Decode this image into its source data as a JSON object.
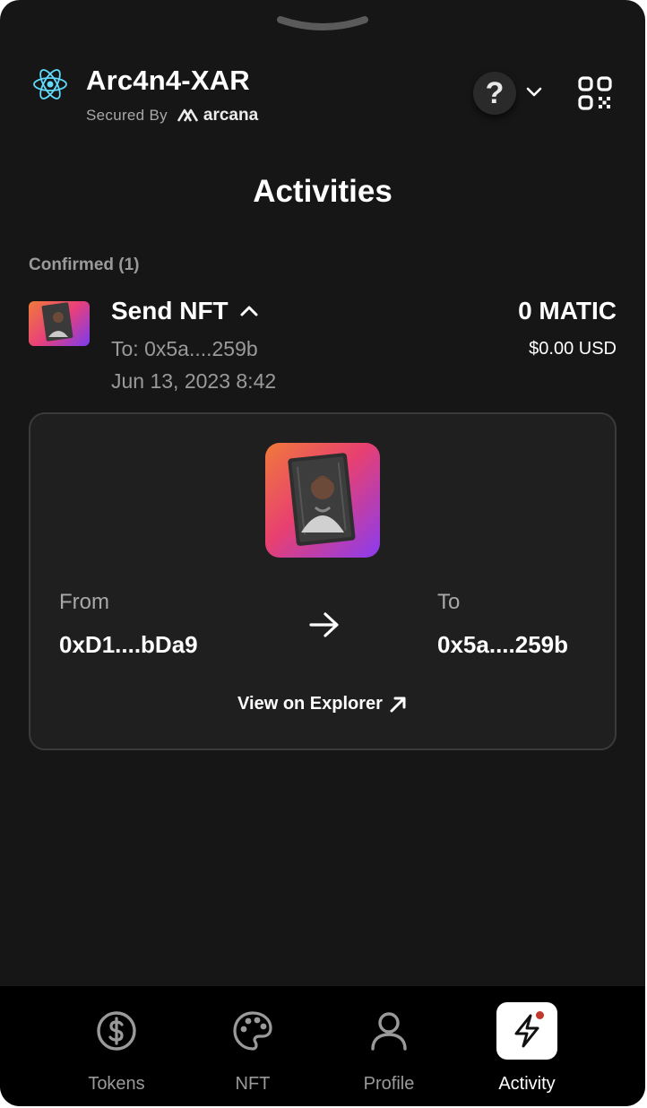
{
  "header": {
    "app_name": "Arc4n4-XAR",
    "secured_by_label": "Secured By",
    "secured_by_brand": "arcana",
    "help_symbol": "?",
    "icons": [
      "react-atom-icon",
      "help-icon",
      "chevron-down-icon",
      "qr-code-icon"
    ]
  },
  "page": {
    "title": "Activities"
  },
  "activities": {
    "section_label": "Confirmed (1)",
    "items": [
      {
        "title": "Send NFT",
        "to": "To: 0x5a....259b",
        "date": "Jun 13, 2023 8:42",
        "amount": "0 MATIC",
        "usd": "$0.00 USD",
        "expanded": true
      }
    ]
  },
  "detail": {
    "from_label": "From",
    "from_address": "0xD1....bDa9",
    "to_label": "To",
    "to_address": "0x5a....259b",
    "explorer_label": "View on Explorer"
  },
  "nav": {
    "items": [
      {
        "label": "Tokens",
        "icon": "dollar-coin-icon",
        "active": false
      },
      {
        "label": "NFT",
        "icon": "palette-icon",
        "active": false
      },
      {
        "label": "Profile",
        "icon": "user-icon",
        "active": false
      },
      {
        "label": "Activity",
        "icon": "lightning-icon",
        "active": true
      }
    ]
  },
  "colors": {
    "background": "#161616",
    "card": "#1f1f1f",
    "nav_background": "#000000",
    "muted_text": "#9a9a9a",
    "notification_dot": "#c0392b",
    "nft_gradient_start": "#f07a3a",
    "nft_gradient_end": "#7a3cf0"
  }
}
